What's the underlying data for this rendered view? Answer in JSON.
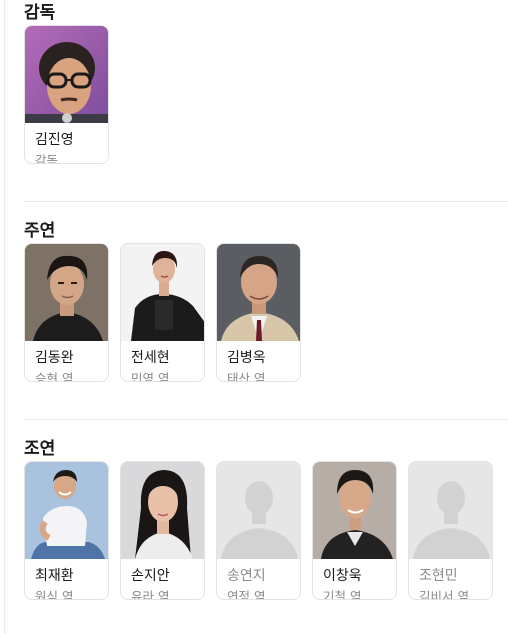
{
  "sections": {
    "director": {
      "title": "감독",
      "people": [
        {
          "name": "김진영",
          "role": "감독"
        }
      ]
    },
    "lead": {
      "title": "주연",
      "people": [
        {
          "name": "김동완",
          "role": "승현 역"
        },
        {
          "name": "전세현",
          "role": "민영 역"
        },
        {
          "name": "김병옥",
          "role": "태산 역"
        }
      ]
    },
    "supporting": {
      "title": "조연",
      "people": [
        {
          "name": "최재환",
          "role": "원식 역"
        },
        {
          "name": "손지안",
          "role": "유라 역"
        },
        {
          "name": "송연지",
          "role": "연정 역"
        },
        {
          "name": "이창욱",
          "role": "기철 역"
        },
        {
          "name": "조현민",
          "role": "김비서 역"
        }
      ]
    }
  },
  "colors": {
    "placeholder_bg": "#e6e6e6",
    "placeholder_silhouette": "#d2d2d2"
  }
}
